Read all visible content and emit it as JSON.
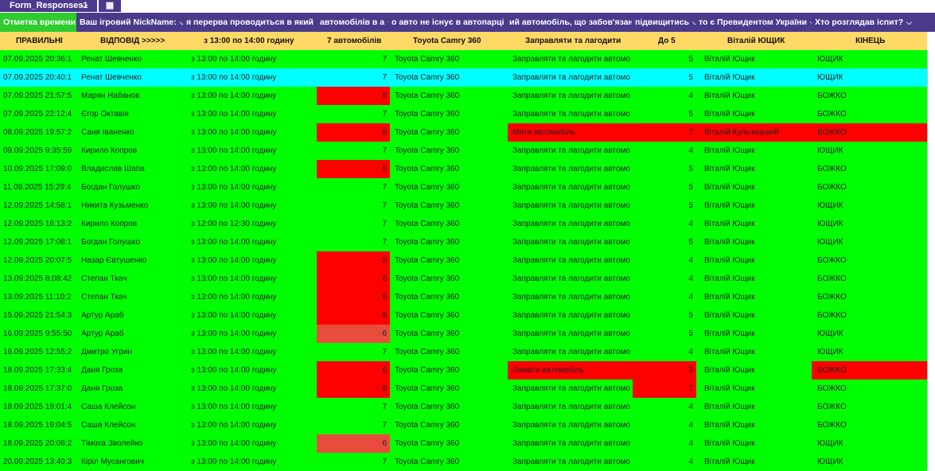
{
  "tabs": {
    "sheet_name": "Form_Responses1",
    "chevron": "⌵",
    "icon_label": "▦"
  },
  "colors": {
    "header": "#4b3a8c",
    "answer": "#ffd966",
    "ok": "#00ff00",
    "bad": "#ff0000",
    "partial": "#e84c3d",
    "highlight": "#00ffff"
  },
  "headers": [
    "Отметка времени",
    "Ваш ігровий NickName:",
    "я перерва проводиться в який",
    "автомобілів в а",
    "о авто не існує в автопарці І",
    "ий автомобіль, що забов'язан",
    "підвищитись",
    "то є Превидентом України",
    "Хто розглядав іспит?"
  ],
  "answers": [
    "ПРАВИЛЬНІ",
    "ВІДПОВІД >>>>>",
    "з 13:00 по 14:00 годину",
    "7 автомобілів",
    "Toyota Camry 360",
    "Заправляти та лагодити",
    "До 5",
    "Віталій ЮЩИК",
    "КІНЕЦЬ"
  ],
  "rows": [
    {
      "ts": "07.09.2025 20:36:1",
      "nick": "Ренат Шевченко",
      "time": "з 13:00 по 14:00 годину",
      "cars": "7",
      "car": "Toyota Camry 360",
      "duty": "Заправляти та лагодити автомо",
      "level": "5",
      "president": "Віталій Ющик",
      "examiner": "ЮЩИК",
      "bg": "green"
    },
    {
      "ts": "07.09.2025 20:40:1",
      "nick": "Ренат Шевченко",
      "time": "з 13:00 по 14:00 годину",
      "cars": "7",
      "car": "Toyota Camry 360",
      "duty": "Заправляти та лагодити автомо",
      "level": "5",
      "president": "Віталій Ющик",
      "examiner": "ЮЩИК",
      "bg": "cyan"
    },
    {
      "ts": "07.09.2025 21:57:5",
      "nick": "Марян Набанов",
      "time": "з 13:00 по 14:00 годину",
      "cars": "6",
      "car": "Toyota Camry 360",
      "duty": "Заправляти та лагодити автомо",
      "level": "4",
      "president": "Віталій Ющик",
      "examiner": "БОЖКО",
      "bg": "green",
      "bad": [
        "cars"
      ]
    },
    {
      "ts": "07.09.2025 22:12:4",
      "nick": "Єгор Октавія",
      "time": "з 13:00 по 14:00 годину",
      "cars": "7",
      "car": "Toyota Camry 360",
      "duty": "Заправляти та лагодити автомо",
      "level": "5",
      "president": "Віталій Ющик",
      "examiner": "БОЖКО",
      "bg": "green"
    },
    {
      "ts": "08.09.2025 19:57:2",
      "nick": "Саня Іваненко",
      "time": "з 13:00 по 14:00 годину",
      "cars": "8",
      "car": "Toyota Camry 360",
      "duty": "Мити автомобіль",
      "level": "7",
      "president": "Віталій Кульчицький",
      "examiner": "БОЖКО",
      "bg": "green",
      "bad": [
        "cars",
        "duty",
        "level",
        "president",
        "examiner"
      ]
    },
    {
      "ts": "09.09.2025 9:35:59",
      "nick": "Кирило Копров",
      "time": "з 13:00 по 14:00 годину",
      "cars": "7",
      "car": "Toyota Camry 360",
      "duty": "Заправляти та лагодити автомо",
      "level": "4",
      "president": "Віталій Ющик",
      "examiner": "ЮЩИК",
      "bg": "green"
    },
    {
      "ts": "10.09.2025 17:09:0",
      "nick": "Владислав Шапа",
      "time": "з 13:00 по 14:00 годину",
      "cars": "5",
      "car": "Toyota Camry 360",
      "duty": "Заправляти та лагодити автомо",
      "level": "5",
      "president": "Віталій Ющик",
      "examiner": "БОЖКО",
      "bg": "green",
      "bad": [
        "cars"
      ]
    },
    {
      "ts": "11.09.2025 15:29:4",
      "nick": "Богдан Голушко",
      "time": "з 13:00 по 14:00 годину",
      "cars": "7",
      "car": "Toyota Camry 360",
      "duty": "Заправляти та лагодити автомо",
      "level": "5",
      "president": "Віталій Ющик",
      "examiner": "БОЖКО",
      "bg": "green"
    },
    {
      "ts": "12.09.2025 14:58:1",
      "nick": "Никита Кузьменко",
      "time": "з 13:00 по 14:00 годину",
      "cars": "7",
      "car": "Toyota Camry 360",
      "duty": "Заправляти та лагодити автомо",
      "level": "5",
      "president": "Віталій Ющик",
      "examiner": "ЮЩИК",
      "bg": "green"
    },
    {
      "ts": "12.09.2025 16:13:2",
      "nick": "Кирило Копров",
      "time": "з 12:00 по 12:30 годину",
      "cars": "7",
      "car": "Toyota Camry 360",
      "duty": "Заправляти та лагодити автомо",
      "level": "4",
      "president": "Віталій Ющик",
      "examiner": "ЮЩИК",
      "bg": "green"
    },
    {
      "ts": "12.09.2025 17:08:1",
      "nick": "Богдан Голушко",
      "time": "з 13:00 по 14:00 годину",
      "cars": "7",
      "car": "Toyota Camry 360",
      "duty": "Заправляти та лагодити автомо",
      "level": "5",
      "president": "Віталій Ющик",
      "examiner": "ЮЩИК",
      "bg": "green"
    },
    {
      "ts": "12.09.2025 20:07:5",
      "nick": "Назар Євтушенко",
      "time": "з 13:00 по 14:00 годину",
      "cars": "5",
      "car": "Toyota Camry 360",
      "duty": "Заправляти та лагодити автомо",
      "level": "4",
      "president": "Віталій Ющик",
      "examiner": "БОЖКО",
      "bg": "green",
      "bad": [
        "cars"
      ]
    },
    {
      "ts": "13.09.2025 8:08:42",
      "nick": "Степан Ткач",
      "time": "з 13:00 по 14:00 годину",
      "cars": "6",
      "car": "Toyota Camry 360",
      "duty": "Заправляти та лагодити автомо",
      "level": "4",
      "president": "Віталій Ющик",
      "examiner": "БОЖКО",
      "bg": "green",
      "bad": [
        "cars"
      ]
    },
    {
      "ts": "13.09.2025 11:10:2",
      "nick": "Степан Ткач",
      "time": "з 13:00 по 14:00 годину",
      "cars": "6",
      "car": "Toyota Camry 360",
      "duty": "Заправляти та лагодити автомо",
      "level": "4",
      "president": "Віталій Ющик",
      "examiner": "БОЖКО",
      "bg": "green",
      "bad": [
        "cars"
      ]
    },
    {
      "ts": "15.09.2025 21:54:3",
      "nick": "Артур Араб",
      "time": "з 13:00 по 14:00 годину",
      "cars": "6",
      "car": "Toyota Camry 360",
      "duty": "Заправляти та лагодити автомо",
      "level": "5",
      "president": "Віталій Ющик",
      "examiner": "БОЖКО",
      "bg": "green",
      "bad": [
        "cars"
      ]
    },
    {
      "ts": "16.09.2025 9:55:50",
      "nick": "Артур Араб",
      "time": "з 13:00 по 14:00 годину",
      "cars": "6",
      "car": "Toyota Camry 360",
      "duty": "Заправляти та лагодити автомо",
      "level": "5",
      "president": "Віталій Ющик",
      "examiner": "ЮЩИК",
      "bg": "green",
      "partial": [
        "cars"
      ]
    },
    {
      "ts": "16.09.2025 12:55:2",
      "nick": "Дмитро Угрин",
      "time": "з 13:00 по 14:00 годину",
      "cars": "7",
      "car": "Toyota Camry 360",
      "duty": "Заправляти та лагодити автомо",
      "level": "4",
      "president": "Віталій Ющик",
      "examiner": "ЮЩИК",
      "bg": "green"
    },
    {
      "ts": "18.09.2025 17:33:4",
      "nick": "Даня Гроза",
      "time": "з 13:00 по 14:00 годину",
      "cars": "6",
      "car": "Toyota Camry 360",
      "duty": "Ламати автомобіль",
      "level": "3",
      "president": "Віталій Ющик",
      "examiner": "БОЖКО",
      "bg": "green",
      "bad": [
        "cars",
        "duty",
        "level",
        "examiner"
      ]
    },
    {
      "ts": "18.09.2025 17:37:0",
      "nick": "Даня Гроза",
      "time": "з 13:00 по 14:00 годину",
      "cars": "6",
      "car": "Toyota Camry 360",
      "duty": "Заправляти та лагодити автомо",
      "level": "7",
      "president": "Віталій Ющик",
      "examiner": "БОЖКО",
      "bg": "green",
      "bad": [
        "cars",
        "level"
      ]
    },
    {
      "ts": "18.09.2025 19:01:4",
      "nick": "Саша Клейсон",
      "time": "з 13:00 по 14:00 годину",
      "cars": "7",
      "car": "Toyota Camry 360",
      "duty": "Заправляти та лагодити автомо",
      "level": "4",
      "president": "Віталій Ющик",
      "examiner": "БОЖКО",
      "bg": "green"
    },
    {
      "ts": "18.09.2025 19:04:5",
      "nick": "Саша Клейсон",
      "time": "з 13:00 по 14:00 годину",
      "cars": "7",
      "car": "Toyota Camry 360",
      "duty": "Заправляти та лагодити автомо",
      "level": "4",
      "president": "Віталій Ющик",
      "examiner": "БОЖКО",
      "bg": "green"
    },
    {
      "ts": "18.09.2025 20:06:2",
      "nick": "Тімоха Зволейко",
      "time": "з 13:00 по 14:00 годину",
      "cars": "6",
      "car": "Toyota Camry 360",
      "duty": "Заправляти та лагодити автомо",
      "level": "4",
      "president": "Віталій Ющик",
      "examiner": "ЮЩИК",
      "bg": "green",
      "partial": [
        "cars"
      ]
    },
    {
      "ts": "20.09.2025 13:40:3",
      "nick": "Кіріл Мусангович",
      "time": "з 13:00 по 14:00 годину",
      "cars": "7",
      "car": "Toyota Camry 360",
      "duty": "Заправляти та лагодити автомо",
      "level": "4",
      "president": "Віталій Ющик",
      "examiner": "ЮЩИК",
      "bg": "green"
    }
  ]
}
